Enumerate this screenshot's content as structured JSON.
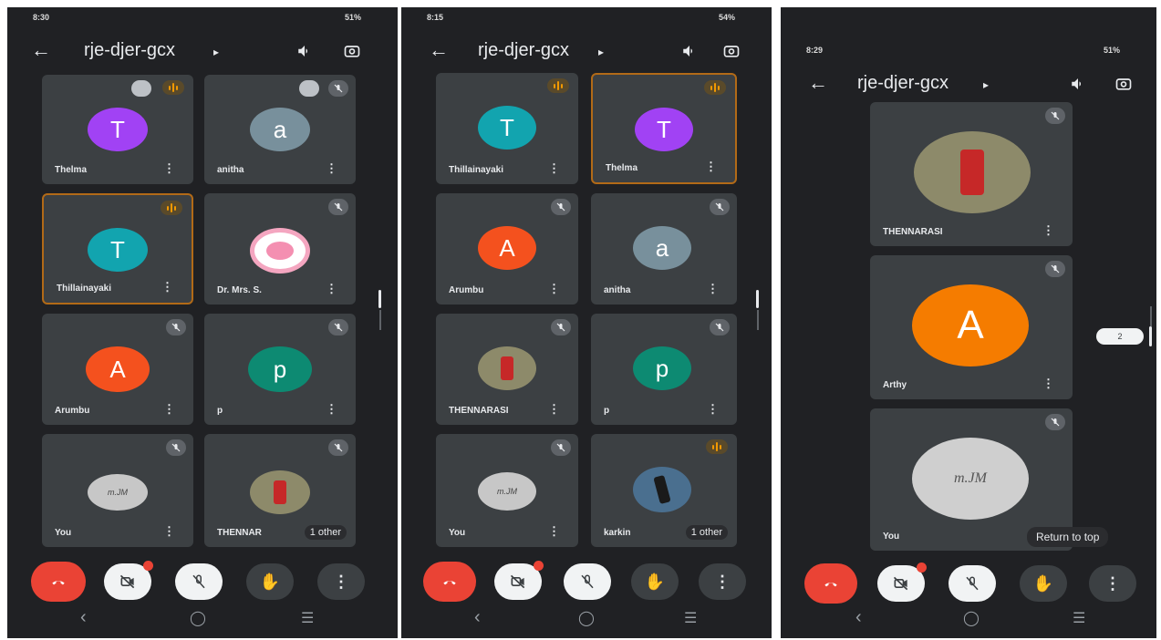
{
  "colors": {
    "bg": "#202124",
    "tile": "#3c4043",
    "end_call": "#ea4335",
    "active_border": "#b26a17",
    "speaking": "#f29900"
  },
  "icons": {
    "back": "arrow-left-icon",
    "audio": "speaker-icon",
    "switch_camera": "switch-camera-icon",
    "mic_off": "mic-off-icon",
    "camera_off": "camera-off-icon",
    "raise_hand": "hand-icon",
    "more": "more-vert-icon",
    "end_call": "phone-hangup-icon"
  },
  "screens": [
    {
      "status_time": "8:30",
      "status_signal": "51%",
      "meeting_code": "rje-djer-gcx",
      "participants": [
        {
          "name": "Thelma",
          "initial": "T",
          "color": "#a142f4",
          "speaking": true,
          "active": false,
          "pinned": true
        },
        {
          "name": "anitha",
          "initial": "a",
          "color": "#78909c",
          "speaking": false,
          "active": false,
          "pinned": true
        },
        {
          "name": "Thillainayaki",
          "initial": "T",
          "color": "#12a4af",
          "speaking": true,
          "active": true
        },
        {
          "name": "Dr. Mrs. S.",
          "initial": "",
          "color": "#f8c1d4",
          "speaking": false,
          "image": "pink-logo"
        },
        {
          "name": "Arumbu",
          "initial": "A",
          "color": "#f4511e",
          "speaking": false
        },
        {
          "name": "p",
          "initial": "p",
          "color": "#0d8a72",
          "speaking": false
        },
        {
          "name": "You",
          "initial": "m.JM",
          "color": "#c7c7c7",
          "speaking": false
        },
        {
          "name": "THENNAR",
          "initial": "",
          "color": "#8d8a6a",
          "speaking": false,
          "image": "photo",
          "extra": "1 other"
        }
      ]
    },
    {
      "status_time": "8:15",
      "status_signal": "54%",
      "meeting_code": "rje-djer-gcx",
      "participants": [
        {
          "name": "Thillainayaki",
          "initial": "T",
          "color": "#12a4af",
          "speaking": true
        },
        {
          "name": "Thelma",
          "initial": "T",
          "color": "#a142f4",
          "speaking": true,
          "active": true
        },
        {
          "name": "Arumbu",
          "initial": "A",
          "color": "#f4511e",
          "speaking": false
        },
        {
          "name": "anitha",
          "initial": "a",
          "color": "#78909c",
          "speaking": false
        },
        {
          "name": "THENNARASI",
          "initial": "",
          "color": "#8d8a6a",
          "speaking": false,
          "image": "photo"
        },
        {
          "name": "p",
          "initial": "p",
          "color": "#0d8a72",
          "speaking": false
        },
        {
          "name": "You",
          "initial": "m.JM",
          "color": "#c7c7c7",
          "speaking": false
        },
        {
          "name": "karkin",
          "initial": "",
          "color": "#4a6f8f",
          "speaking": true,
          "image": "photo2",
          "extra": "1 other"
        }
      ]
    },
    {
      "status_time": "8:29",
      "status_signal": "51%",
      "meeting_code": "rje-djer-gcx",
      "participants": [
        {
          "name": "THENNARASI",
          "initial": "",
          "color": "#8d8a6a",
          "speaking": false,
          "image": "photo"
        },
        {
          "name": "Arthy",
          "initial": "A",
          "color": "#f57c00",
          "speaking": false
        },
        {
          "name": "You",
          "initial": "m.JM",
          "color": "#cfcfcf",
          "speaking": false
        }
      ],
      "return_to_top": "Return to top",
      "page_indicator": "2"
    }
  ]
}
